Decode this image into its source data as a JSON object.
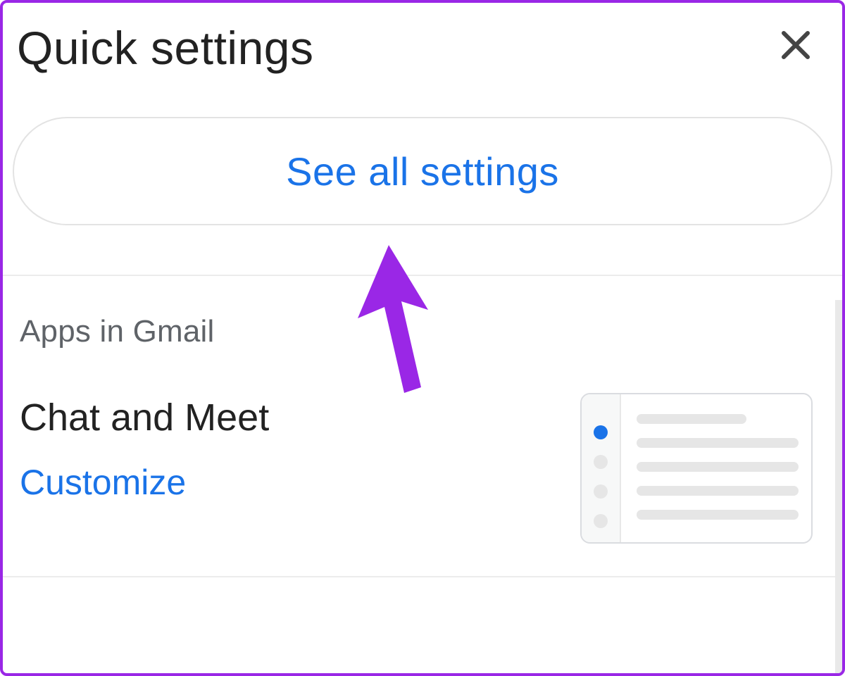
{
  "panel": {
    "title": "Quick settings",
    "see_all_label": "See all settings"
  },
  "section": {
    "title": "Apps in Gmail",
    "option": {
      "label": "Chat and Meet",
      "link_label": "Customize"
    }
  },
  "icons": {
    "close": "close-icon"
  },
  "annotation": {
    "color": "#9a27e6",
    "pointing_to": "see-all-settings-button"
  },
  "colors": {
    "link": "#1a73e8",
    "text": "#222222",
    "muted": "#5f6368",
    "border": "#e3e3e3",
    "accent": "#9a27e6"
  }
}
